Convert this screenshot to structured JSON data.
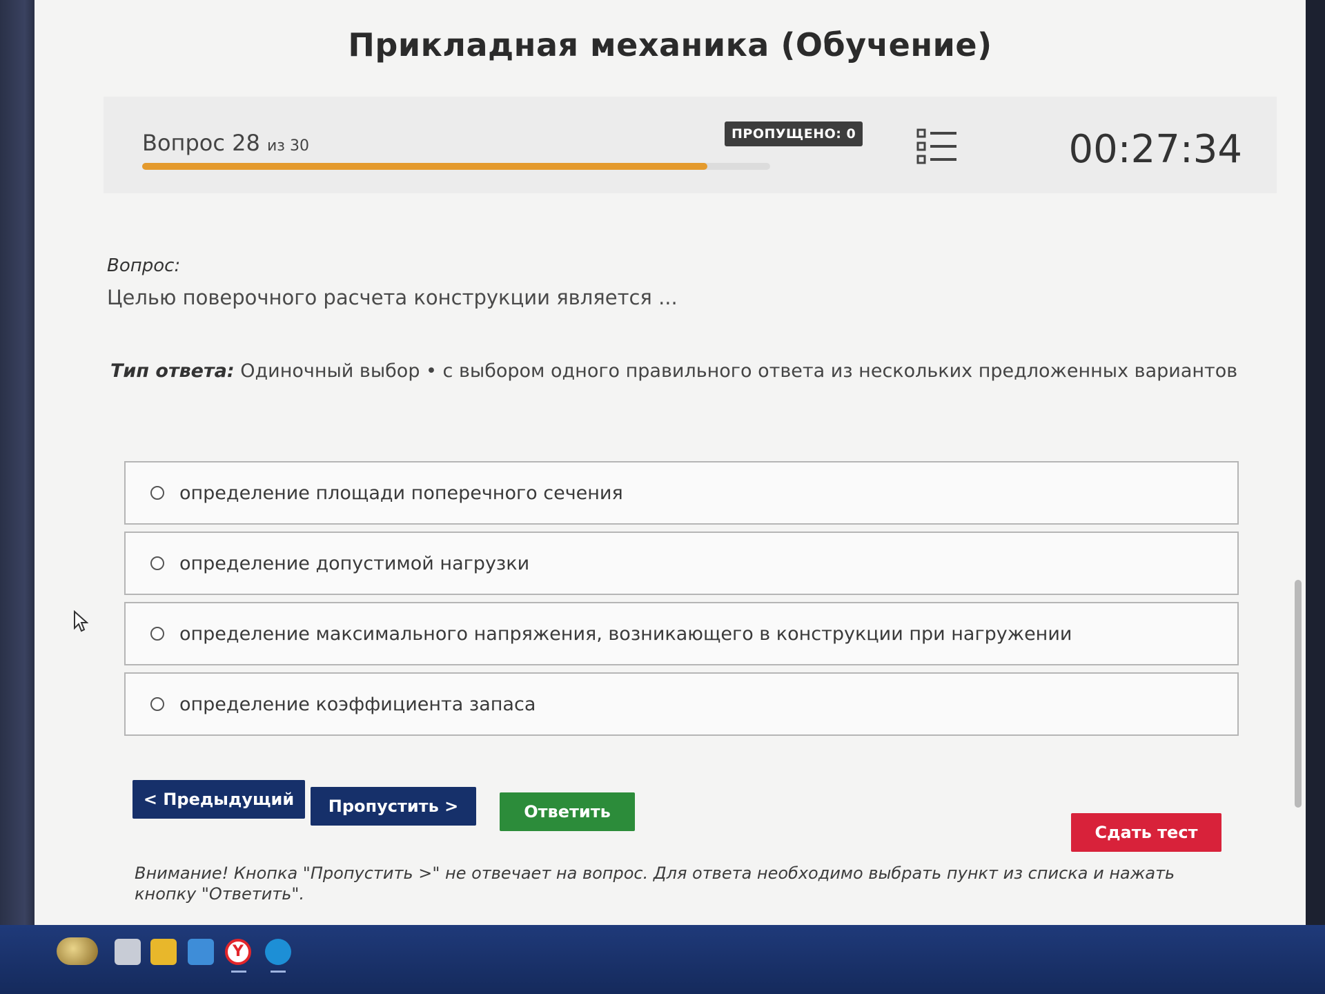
{
  "page": {
    "title": "Прикладная механика (Обучение)"
  },
  "header": {
    "question_word": "Вопрос",
    "question_current": "28",
    "question_of": "из 30",
    "progress_fraction": 0.9,
    "skipped_badge": "ПРОПУЩЕНО: 0",
    "timer": "00:27:34",
    "list_icon": "list-icon"
  },
  "question": {
    "label": "Вопрос:",
    "text": "Целью поверочного расчета конструкции является ...",
    "answer_type_label": "Тип ответа:",
    "answer_type_value": " Одиночный выбор • с выбором одного правильного ответа из нескольких предложенных вариантов"
  },
  "options": [
    "определение площади поперечного сечения",
    "определение допустимой нагрузки",
    "определение максимального напряжения, возникающего в конструкции при нагружении",
    "определение коэффициента запаса"
  ],
  "buttons": {
    "prev": "< Предыдущий",
    "skip": "Пропустить >",
    "answer": "Ответить",
    "submit": "Сдать тест"
  },
  "notice": "Внимание! Кнопка \"Пропустить >\" не отвечает на вопрос. Для ответа необходимо выбрать пункт из списка и нажать кнопку \"Ответить\".",
  "colors": {
    "progress": "#e49a2d",
    "nav_button": "#16306a",
    "answer_button": "#2c8c3a",
    "submit_button": "#d8223a",
    "badge": "#3d3d3d"
  }
}
